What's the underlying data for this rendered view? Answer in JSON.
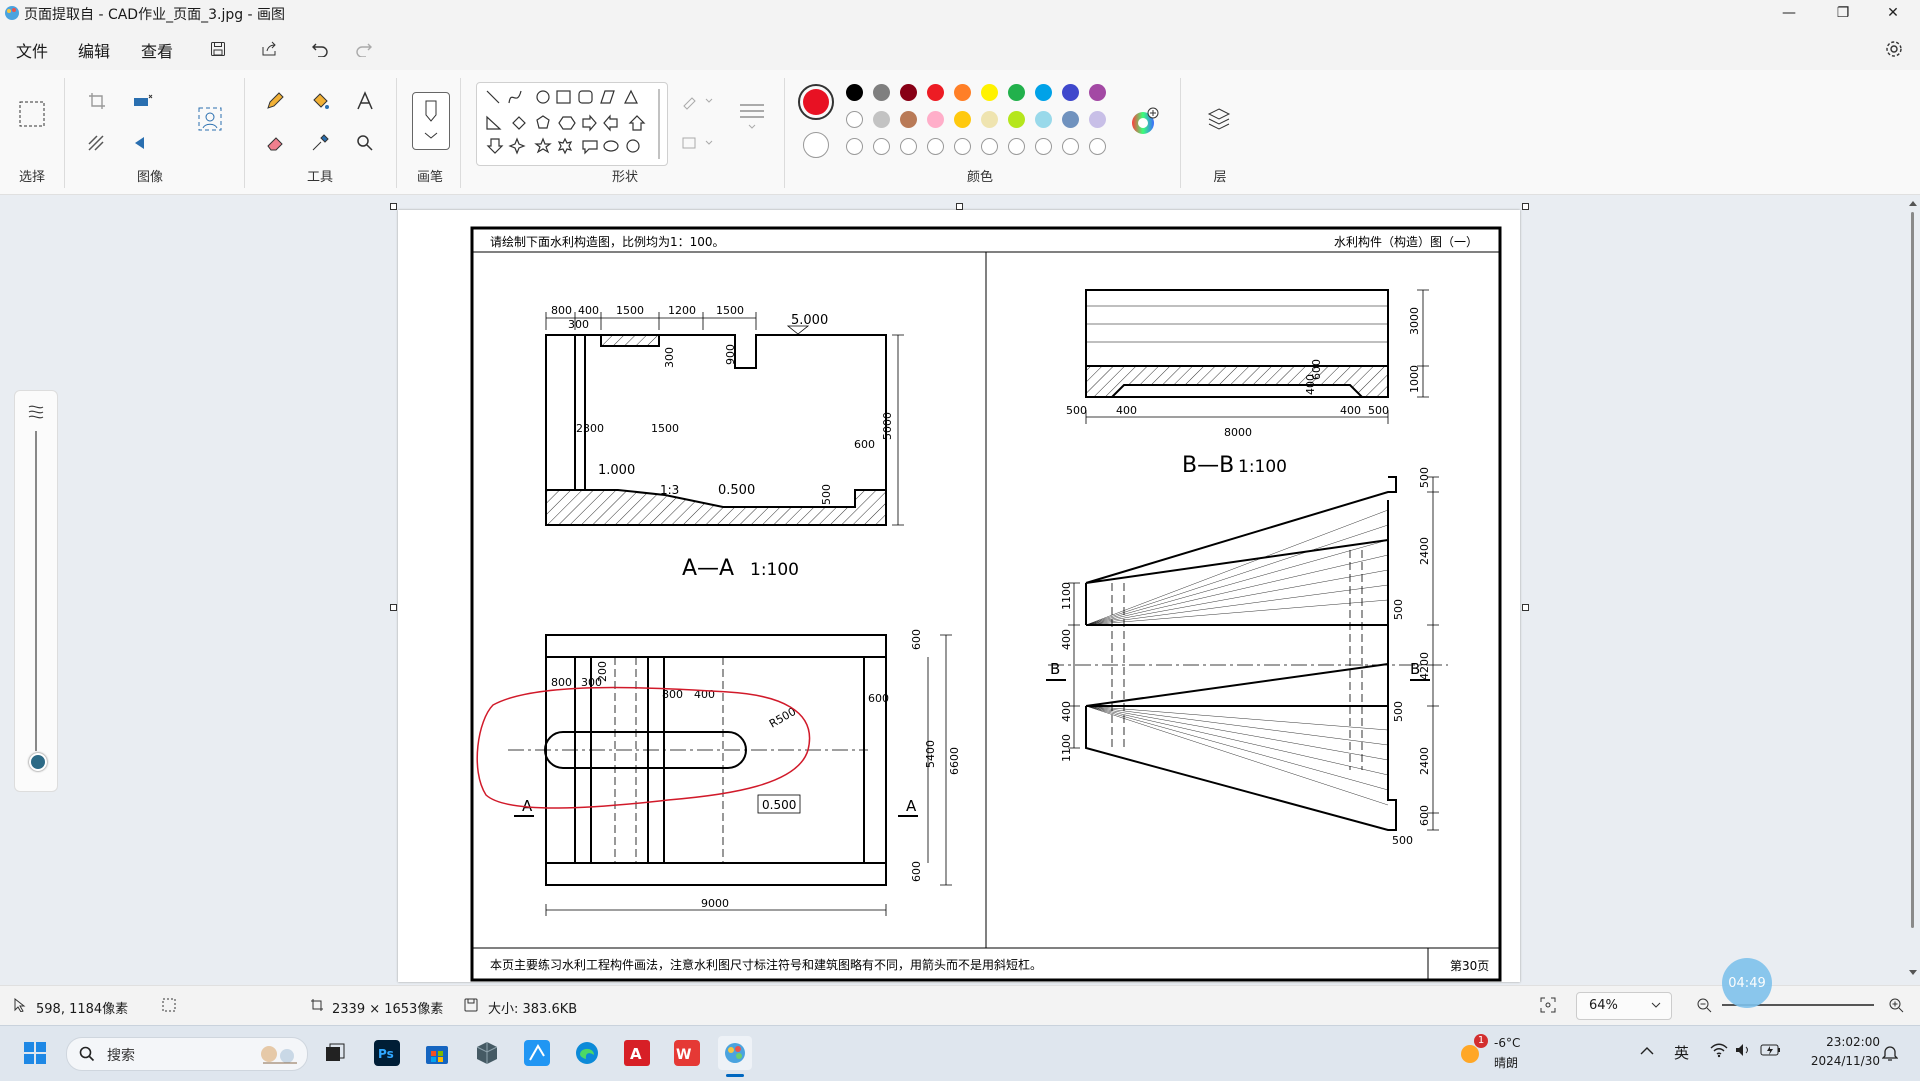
{
  "window": {
    "title": "页面提取自 - CAD作业_页面_3.jpg - 画图",
    "minimize": "—",
    "maximize": "❐",
    "close": "✕"
  },
  "menu": {
    "file": "文件",
    "edit": "编辑",
    "view": "查看"
  },
  "ribbon": {
    "groups": {
      "select": "选择",
      "image": "图像",
      "tools": "工具",
      "brush": "画笔",
      "shapes": "形状",
      "colors": "颜色",
      "layers": "层"
    },
    "selected_color": "#e81123",
    "palette_row1": [
      "#000000",
      "#7f7f7f",
      "#880015",
      "#ed1c24",
      "#ff7f27",
      "#fff200",
      "#22b14c",
      "#00a2e8",
      "#3f48cc",
      "#a349a4"
    ],
    "palette_row2": [
      "#ffffff",
      "#c3c3c3",
      "#b97a57",
      "#ffaec9",
      "#ffc90e",
      "#efe4b0",
      "#b5e61d",
      "#99d9ea",
      "#7092be",
      "#c8bfe7"
    ]
  },
  "drawing": {
    "instruction": "请绘制下面水利构造图，比例均为1：100。",
    "sheet_title": "水利构件（构造）图（一）",
    "footer": "本页主要练习水利工程构件画法，注意水利图尺寸标注符号和建筑图略有不同，用箭头而不是用斜短杠。",
    "page_no": "第30页",
    "section_aa": "A—A",
    "section_bb": "B—B",
    "scale": "1:100",
    "aa_dims_top": [
      "800",
      "400",
      "1500",
      "1200",
      "1500"
    ],
    "aa_dim_300": "300",
    "aa_elev_top": "5.000",
    "aa_elev_1": "1.000",
    "aa_elev_2": "0.500",
    "aa_slope": "1:3",
    "aa_height": "5000",
    "aa_dim_2300": "2300",
    "aa_dim_1500": "1500",
    "aa_dim_300v": "300",
    "aa_dim_900": "900",
    "aa_dim_600": "600",
    "aa_dim_500": "500",
    "plan_width": "9000",
    "plan_height": "6600",
    "plan_inner": "5400",
    "plan_600a": "600",
    "plan_600b": "600",
    "plan_600c": "600",
    "plan_800": "800",
    "plan_300": "300",
    "plan_200": "200",
    "plan_800b": "800",
    "plan_400": "400",
    "plan_r500": "R500",
    "plan_elev": "0.500",
    "marker_a": "A",
    "marker_b": "B",
    "bb_width": "8000",
    "bb_3000": "3000",
    "bb_1000": "1000",
    "bb_500a": "500",
    "bb_400a": "400",
    "bb_400b": "400",
    "bb_400c": "400",
    "bb_500b": "500",
    "bb_600": "600",
    "rp_500": "500",
    "rp_2400": "2400",
    "rp_500b": "500",
    "rp_4200": "4200",
    "rp_500c": "500",
    "rp_2400b": "2400",
    "rp_600": "600",
    "rp_500d": "500",
    "rp_1100": "1100",
    "rp_400": "400",
    "rp_400b": "400",
    "rp_1100b": "1100"
  },
  "status": {
    "cursor": "598, 1184像素",
    "dimensions": "2339 × 1653像素",
    "size": "大小: 383.6KB",
    "zoom": "64%",
    "timer": "04:49"
  },
  "taskbar": {
    "search": "搜索",
    "weather_temp": "-6°C",
    "weather_desc": "晴朗",
    "weather_badge": "1",
    "ime": "英",
    "time": "23:02:00",
    "date": "2024/11/30"
  }
}
